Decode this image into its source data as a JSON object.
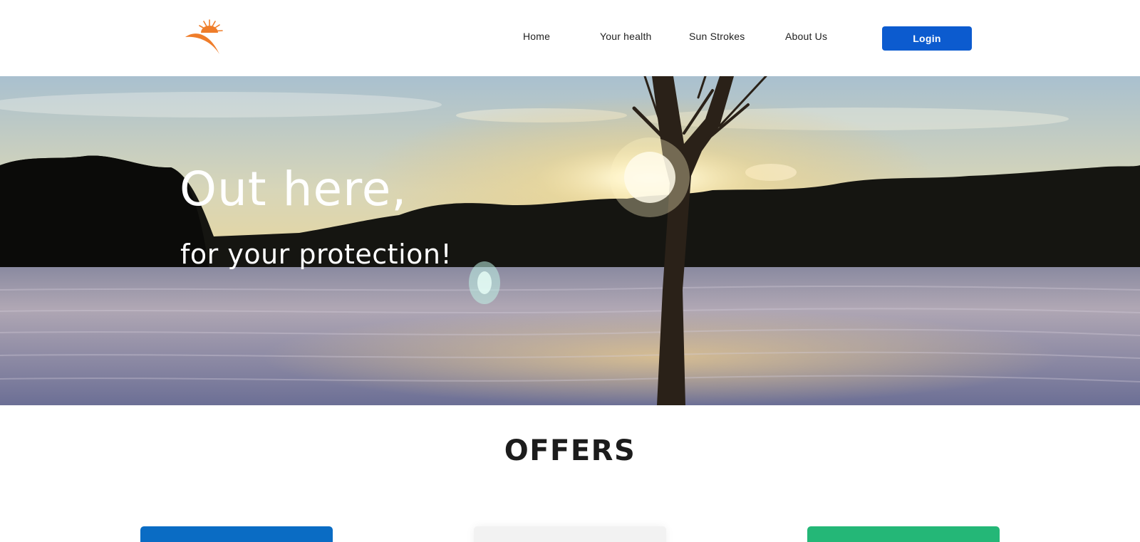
{
  "header": {
    "logo_icon": "sun-logo-icon",
    "nav": [
      {
        "label": "Home"
      },
      {
        "label": "Your health"
      },
      {
        "label": "Sun Strokes"
      },
      {
        "label": "About Us"
      }
    ],
    "login_label": "Login"
  },
  "hero": {
    "title": "Out here,",
    "subtitle": "for your protection!",
    "image": "sunset-over-snowy-field-with-tree"
  },
  "offers": {
    "title": "OFFERS",
    "cards": [
      {
        "color": "#0a6cc4"
      },
      {
        "color": "#f2f2f2"
      },
      {
        "color": "#24b777"
      }
    ]
  },
  "colors": {
    "accent": "#0c5bcf",
    "logo": "#ef7d2a"
  }
}
